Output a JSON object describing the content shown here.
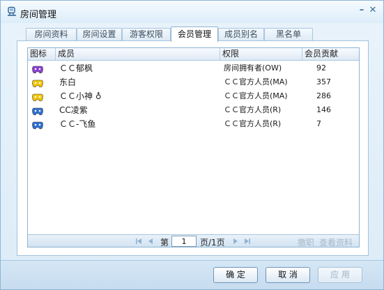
{
  "window": {
    "title": "房间管理",
    "min_icon": "minimize-icon",
    "close_icon": "close-icon"
  },
  "tabs": [
    {
      "label": "房间资料",
      "active": false
    },
    {
      "label": "房间设置",
      "active": false
    },
    {
      "label": "游客权限",
      "active": false
    },
    {
      "label": "会员管理",
      "active": true
    },
    {
      "label": "成员别名",
      "active": false
    },
    {
      "label": "黑名单",
      "active": false
    }
  ],
  "columns": {
    "icon": "图标",
    "member": "成员",
    "role": "权限",
    "score": "会员贡献"
  },
  "members": [
    {
      "icon": "purple-gamepad-icon",
      "icon_color": "#8a3fd1",
      "name": "ＣＣ郁枫",
      "role": "房间拥有者(OW)",
      "score": "92"
    },
    {
      "icon": "yellow-gamepad-icon",
      "icon_color": "#f2c400",
      "name": "东白",
      "role": "ＣＣ官方人员(MA)",
      "score": "357"
    },
    {
      "icon": "yellow-gamepad-icon",
      "icon_color": "#f2c400",
      "name": "ＣＣ小神 ♁",
      "role": "ＣＣ官方人员(MA)",
      "score": "286"
    },
    {
      "icon": "blue-gamepad-icon",
      "icon_color": "#2f6fd1",
      "name": "CC凌紫",
      "role": "ＣＣ官方人员(R)",
      "score": "146"
    },
    {
      "icon": "blue-gamepad-icon",
      "icon_color": "#2f6fd1",
      "name": "ＣＣ-飞鱼",
      "role": "ＣＣ官方人员(R)",
      "score": "7"
    }
  ],
  "pagination": {
    "page_prefix": "第",
    "page_value": "1",
    "page_suffix": "页/1页"
  },
  "actions": {
    "demote": "撤职",
    "view_info": "查看资料"
  },
  "buttons": {
    "ok": "确 定",
    "cancel": "取 消",
    "apply": "应 用"
  },
  "colors": {
    "accent": "#8fb4d3",
    "disabled_text": "#a8b8c8"
  }
}
